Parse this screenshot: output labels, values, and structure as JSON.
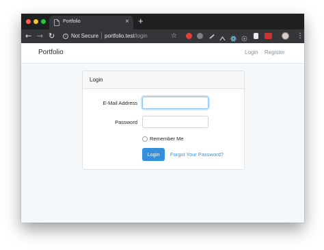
{
  "browser": {
    "tab_title": "Portfolio",
    "tab_close": "×",
    "new_tab": "+",
    "security_label": "Not Secure",
    "url_host": "portfolio.test",
    "url_path": "/login",
    "icons": [
      "back-arrow-icon",
      "forward-arrow-icon",
      "reload-icon",
      "info-icon",
      "star-icon",
      "menu-icon"
    ],
    "extension_colors": [
      "#e5403a",
      "#7d7f83",
      "#c9c9c9",
      "#e8eaed",
      "#61dafb",
      "#9aa0a6",
      "#e8eaed",
      "#cc3333"
    ]
  },
  "navbar": {
    "brand": "Portfolio",
    "login_link": "Login",
    "register_link": "Register"
  },
  "login_card": {
    "title": "Login",
    "email_label": "E-Mail Address",
    "email_value": "",
    "password_label": "Password",
    "password_value": "",
    "remember_label": "Remember Me",
    "submit_label": "Login",
    "forgot_link": "Forgot Your Password?"
  },
  "colors": {
    "primary": "#3490dc",
    "page_background": "#f5f8fa"
  }
}
